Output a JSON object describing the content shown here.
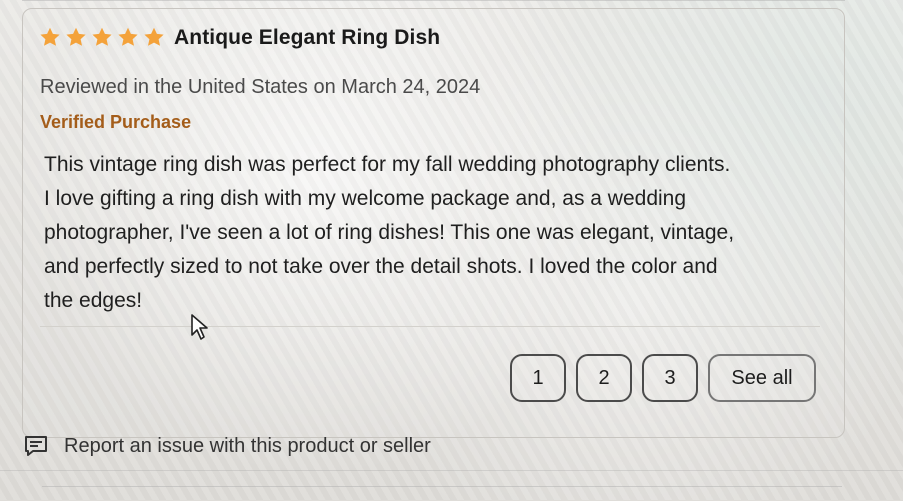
{
  "review": {
    "rating_stars": 5,
    "title": "Antique Elegant Ring Dish",
    "meta": "Reviewed in the United States on March 24, 2024",
    "verified_label": "Verified Purchase",
    "body_lines": [
      "This vintage ring dish was perfect for my fall wedding photography clients.",
      "I love gifting a ring dish with my welcome package and, as a wedding",
      "photographer, I've seen a lot of ring dishes! This one was elegant, vintage,",
      "and perfectly sized to not take over the detail shots. I loved the color and",
      "the edges!"
    ]
  },
  "pager": {
    "pages": [
      "1",
      "2",
      "3"
    ],
    "see_all": "See all"
  },
  "footer": {
    "report_text": "Report an issue with this product or seller"
  },
  "colors": {
    "star": "#f4a23a",
    "verified": "#a45d1a"
  },
  "icons": {
    "star": "star-icon",
    "cursor": "cursor-icon",
    "report": "report-icon"
  }
}
